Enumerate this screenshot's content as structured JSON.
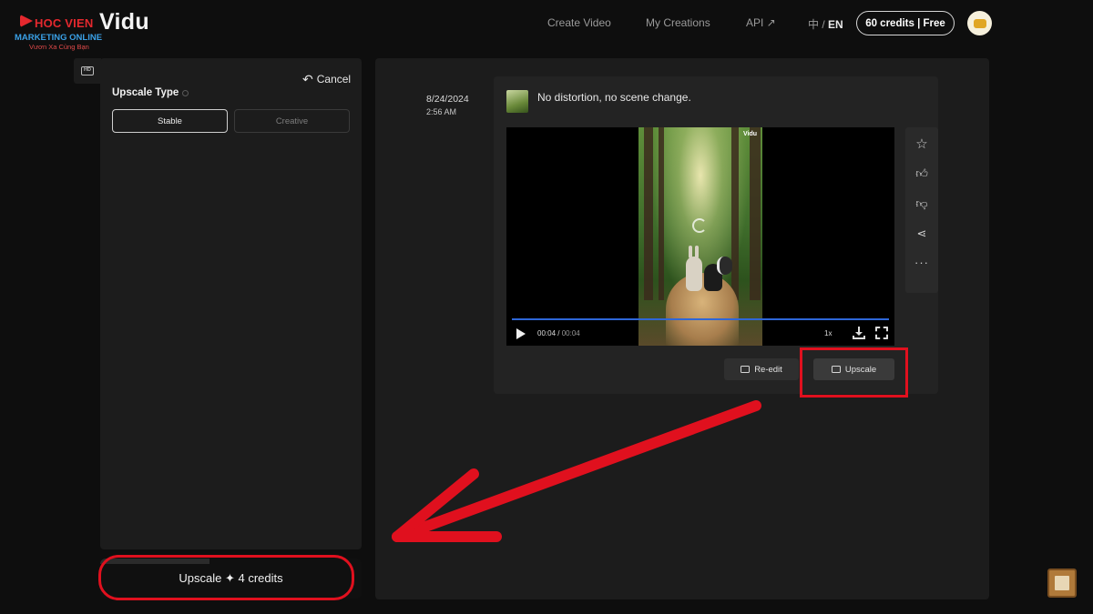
{
  "brand": {
    "watermark_title": "HOC VIEN",
    "watermark_subtitle": "MARKETING ONLINE",
    "watermark_tagline": "Vươn Xa Cùng Bạn",
    "app_name": "Vidu"
  },
  "nav": {
    "create_video": "Create Video",
    "my_creations": "My Creations",
    "api": "API ↗",
    "lang_zh": "中",
    "lang_sep": " / ",
    "lang_en": "EN",
    "credits": "60 credits | Free"
  },
  "left_panel": {
    "hd_badge": "HD",
    "cancel": "Cancel",
    "upscale_type_label": "Upscale Type",
    "options": [
      {
        "label": "Stable",
        "selected": true
      },
      {
        "label": "Creative",
        "selected": false
      }
    ],
    "action_button": "Upscale ✦ 4 credits"
  },
  "result": {
    "date": "8/24/2024",
    "time": "2:56 AM",
    "prompt": "No distortion, no scene change.",
    "video": {
      "watermark": "Vidu",
      "current_time": "00:04",
      "total_time": "00:04",
      "speed": "1x",
      "progress": 1.0
    },
    "buttons": {
      "reedit": "Re-edit",
      "upscale": "Upscale"
    }
  },
  "colors": {
    "accent_progress": "#2e66d8",
    "annotation_red": "#e0101e",
    "background": "#0e0e0e",
    "panel": "#1c1c1c"
  },
  "icons": [
    "star-icon",
    "thumbs-up-icon",
    "thumbs-down-icon",
    "share-icon",
    "more-icon",
    "download-icon",
    "fullscreen-icon",
    "play-icon",
    "undo-arrow-icon",
    "hd-icon"
  ]
}
